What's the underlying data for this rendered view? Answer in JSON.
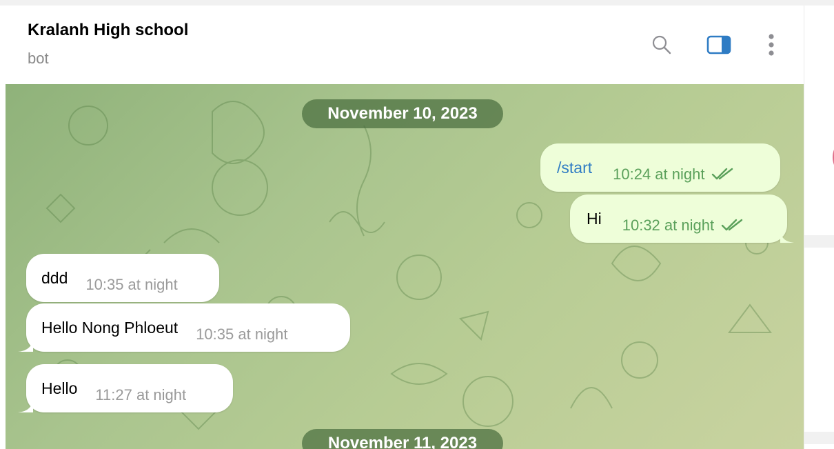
{
  "chat": {
    "title": "Kralanh High school",
    "subtitle": "bot"
  },
  "header_icons": {
    "search": "search-icon",
    "sidebar_toggle": "sidebar-toggle-icon",
    "more": "more-vertical-icon"
  },
  "dates": [
    "November 10, 2023",
    "November 11, 2023"
  ],
  "messages": [
    {
      "direction": "outgoing",
      "text": "/start",
      "time": "10:24 at night",
      "status": "read"
    },
    {
      "direction": "outgoing",
      "text": "Hi",
      "time": "10:32 at night",
      "status": "read"
    },
    {
      "direction": "incoming",
      "text": "ddd",
      "time": "10:35 at night"
    },
    {
      "direction": "incoming",
      "text": "Hello Nong Phloeut",
      "time": "10:35 at night"
    },
    {
      "direction": "incoming",
      "text": "Hello",
      "time": "11:27 at night"
    }
  ],
  "colors": {
    "outgoing_bubble": "#eefed9",
    "incoming_bubble": "#ffffff",
    "accent": "#2f7cc4",
    "read_tick": "#5aa05a",
    "date_pill": "#4a6e3e"
  }
}
